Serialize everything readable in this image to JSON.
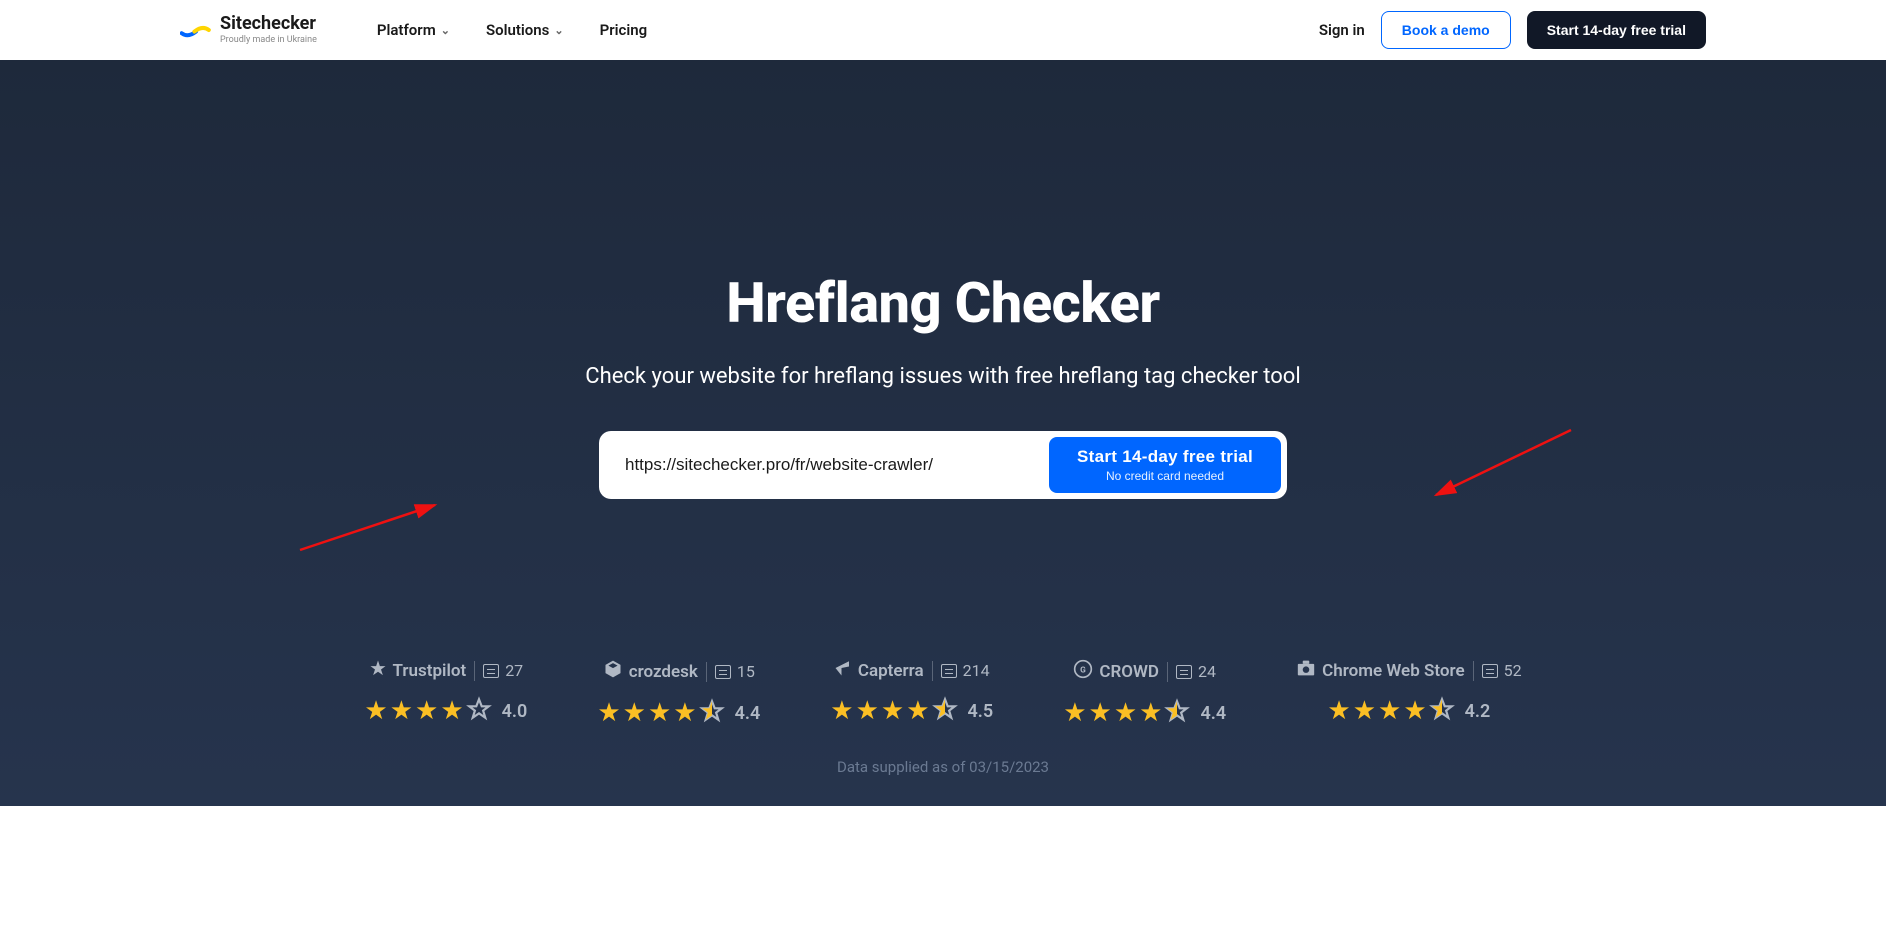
{
  "header": {
    "brand": "Sitechecker",
    "tagline": "Proudly made in Ukraine",
    "nav": {
      "platform": "Platform",
      "solutions": "Solutions",
      "pricing": "Pricing"
    },
    "signin": "Sign in",
    "demo": "Book a demo",
    "trial": "Start 14-day free trial"
  },
  "hero": {
    "title": "Hreflang Checker",
    "subtitle": "Check your website for hreflang issues with free hreflang tag checker tool",
    "input_value": "https://sitechecker.pro/fr/website-crawler/",
    "cta_title": "Start 14-day free trial",
    "cta_sub": "No credit card needed"
  },
  "ratings": [
    {
      "name": "Trustpilot",
      "count": "27",
      "score": "4.0",
      "full": 4,
      "half": 0,
      "outline": 1
    },
    {
      "name": "crozdesk",
      "count": "15",
      "score": "4.4",
      "full": 4,
      "half": 1,
      "outline": 0
    },
    {
      "name": "Capterra",
      "count": "214",
      "score": "4.5",
      "full": 4,
      "half": 1,
      "outline": 0
    },
    {
      "name": "CROWD",
      "count": "24",
      "score": "4.4",
      "full": 4,
      "half": 1,
      "outline": 0
    },
    {
      "name": "Chrome Web Store",
      "count": "52",
      "score": "4.2",
      "full": 4,
      "half": 1,
      "outline": 0
    }
  ],
  "data_note": "Data supplied as of 03/15/2023"
}
